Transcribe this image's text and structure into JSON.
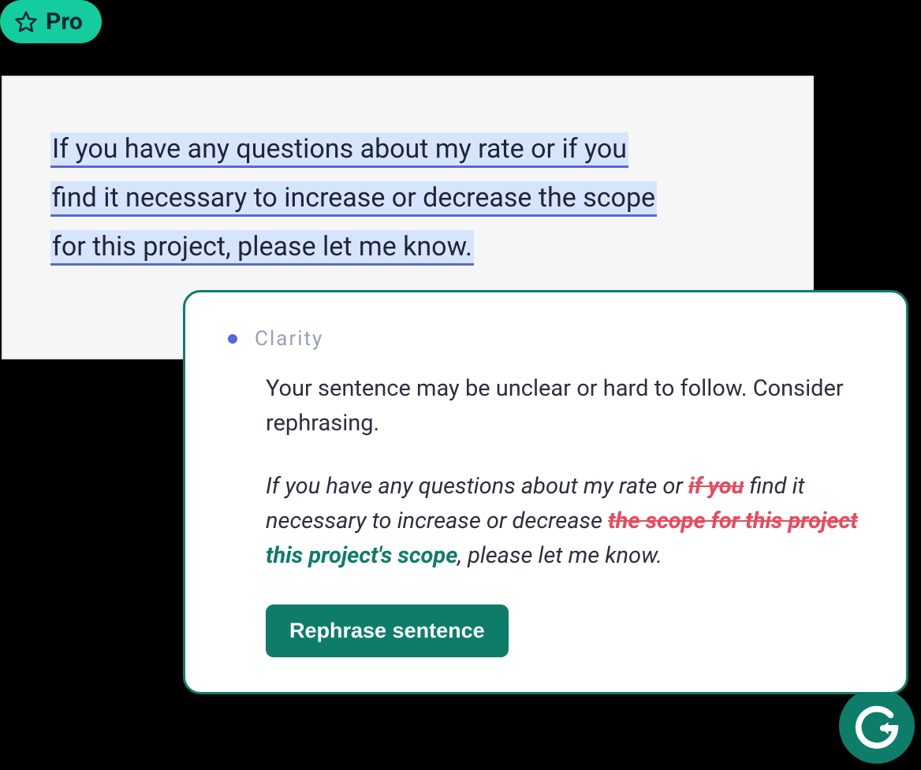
{
  "pro_badge": {
    "label": "Pro"
  },
  "editor": {
    "line1": "If you have any questions about my rate or if you",
    "line2": "find it necessary to increase or decrease the scope",
    "line3": "for this project, please let me know."
  },
  "suggestion": {
    "category": "Clarity",
    "explanation": "Your sentence may be unclear or hard to follow. Consider rephrasing.",
    "rewrite": {
      "p1": "If you have any questions about my rate or ",
      "s1": "if you",
      "p2": " find it necessary to increase or decrease ",
      "s2": "the scope for this project",
      "i1": " this project's scope",
      "p3": ", please let me know."
    },
    "button": "Rephrase sentence"
  }
}
